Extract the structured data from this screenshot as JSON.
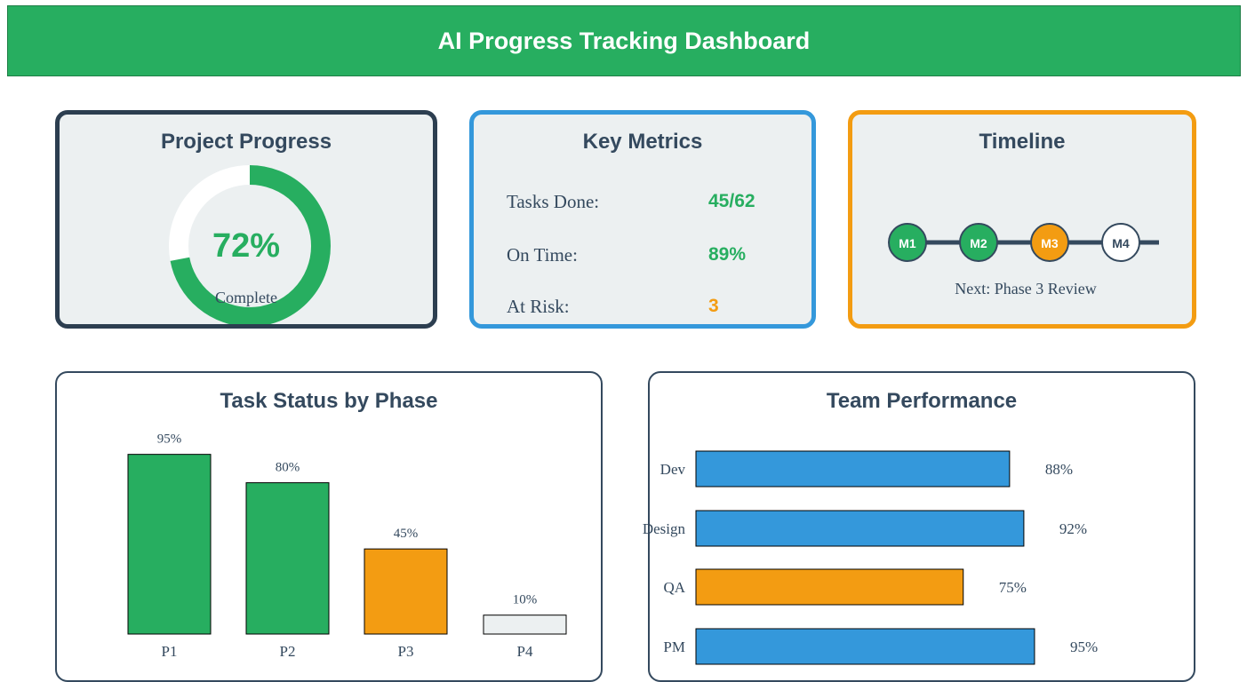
{
  "header": {
    "title": "AI Progress Tracking Dashboard"
  },
  "progress": {
    "title": "Project Progress",
    "percent_label": "72%",
    "sub_label": "Complete",
    "value": 0.72
  },
  "metrics": {
    "title": "Key Metrics",
    "items": [
      {
        "label": "Tasks Done:",
        "value": "45/62",
        "color": "#27ae60"
      },
      {
        "label": "On Time:",
        "value": "89%",
        "color": "#27ae60"
      },
      {
        "label": "At Risk:",
        "value": "3",
        "color": "#f39c12"
      }
    ]
  },
  "timeline": {
    "title": "Timeline",
    "milestones": [
      {
        "label": "M1",
        "status": "done",
        "color": "#27ae60"
      },
      {
        "label": "M2",
        "status": "done",
        "color": "#27ae60"
      },
      {
        "label": "M3",
        "status": "current",
        "color": "#f39c12"
      },
      {
        "label": "M4",
        "status": "pending",
        "color": "#ffffff"
      }
    ],
    "next_label": "Next: Phase 3 Review"
  },
  "task_status": {
    "title": "Task Status by Phase"
  },
  "team_performance": {
    "title": "Team Performance"
  },
  "chart_data": [
    {
      "type": "bar",
      "title": "Task Status by Phase",
      "categories": [
        "P1",
        "P2",
        "P3",
        "P4"
      ],
      "values": [
        95,
        80,
        45,
        10
      ],
      "value_labels": [
        "95%",
        "80%",
        "45%",
        "10%"
      ],
      "colors": [
        "#27ae60",
        "#27ae60",
        "#f39c12",
        "#ecf0f1"
      ],
      "ylim": [
        0,
        100
      ]
    },
    {
      "type": "bar",
      "orientation": "horizontal",
      "title": "Team Performance",
      "categories": [
        "Dev",
        "Design",
        "QA",
        "PM"
      ],
      "values": [
        88,
        92,
        75,
        95
      ],
      "value_labels": [
        "88%",
        "92%",
        "75%",
        "95%"
      ],
      "colors": [
        "#3498db",
        "#3498db",
        "#f39c12",
        "#3498db"
      ],
      "xlim": [
        0,
        100
      ]
    }
  ]
}
